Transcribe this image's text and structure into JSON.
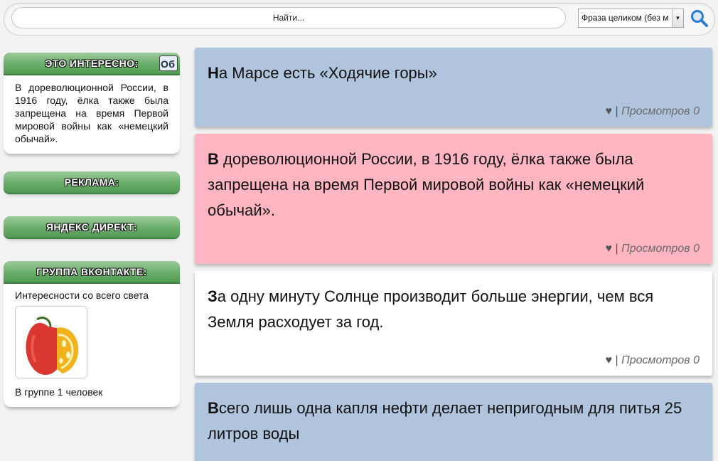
{
  "search": {
    "placeholder": "Найти...",
    "mode_selected": "Фраза целиком (без м",
    "colors": {
      "icon": "#2a7bd6"
    }
  },
  "sidebar": {
    "interesting": {
      "title": "ЭТО ИНТЕРЕСНО:",
      "badge": "Об",
      "text": "В дореволюционной России, в 1916 году, ёлка также была запрещена на время Первой мировой войны как «немецкий обычай»."
    },
    "ads": {
      "title": "РЕКЛАМА:"
    },
    "direct": {
      "title": "ЯНДЕКС ДИРЕКТ:"
    },
    "vk": {
      "title": "ГРУППА ВКОНТАКТЕ:",
      "group_name": "Интересности со всего света",
      "members": "В группе 1 человек"
    },
    "colors": {
      "header": "#69ad6a"
    }
  },
  "facts": [
    {
      "initial": "Н",
      "rest": "а Марсе есть «Ходячие горы»",
      "heart": "♥",
      "sep": "|",
      "views": "Просмотров 0",
      "bg": "#b0c4de"
    },
    {
      "initial": "В",
      "rest": " дореволюционной России, в 1916 году, ёлка также была запрещена на время Первой мировой войны как «немецкий обычай».",
      "heart": "♥",
      "sep": "|",
      "views": "Просмотров 0",
      "bg": "#ffb6c1"
    },
    {
      "initial": "З",
      "rest": "а одну минуту Солнце производит больше энергии, чем вся Земля расходует за год.",
      "heart": "♥",
      "sep": "|",
      "views": "Просмотров 0",
      "bg": "#ffffff"
    },
    {
      "initial": "В",
      "rest": "сего лишь одна капля нефти делает непригодным для питья 25 литров воды",
      "bg": "#b0c4de"
    }
  ]
}
